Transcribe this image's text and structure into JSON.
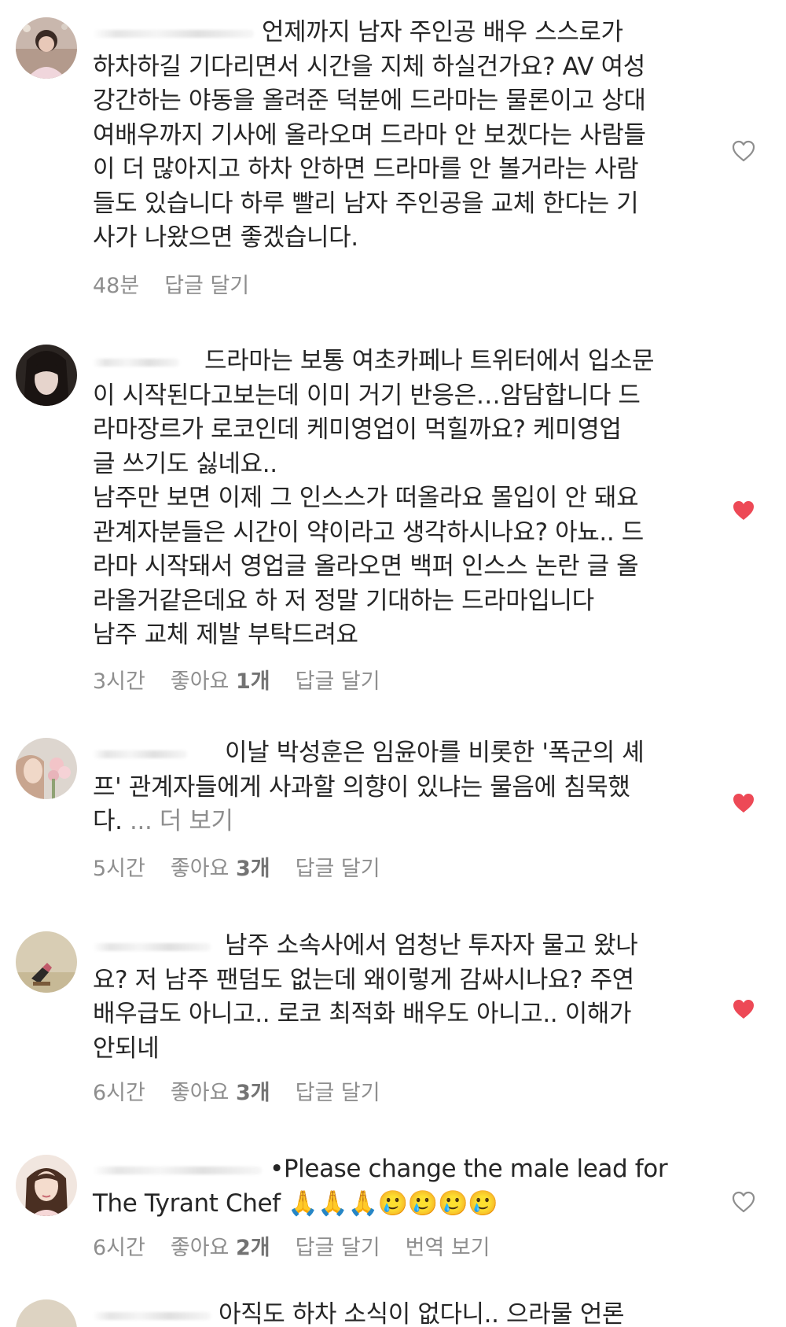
{
  "comments": [
    {
      "text_lines": [
        "언제까지 남자 주인공 배우 스스로가",
        "하차하길 기다리면서 시간을 지체 하실건가요? AV 여성",
        "강간하는 야동을 올려준 덕분에 드라마는 물론이고 상대",
        "여배우까지 기사에 올라오며 드라마 안 보겠다는 사람들",
        "이 더 많아지고 하차 안하면 드라마를 안 볼거라는 사람",
        "들도 있습니다 하루 빨리 남자 주인공을 교체 한다는 기",
        "사가 나왔으면 좋겠습니다."
      ],
      "time": "48분",
      "reply": "답글 달기",
      "liked": false
    },
    {
      "text_lines": [
        "드라마는 보통 여초카페나 트위터에서 입소문",
        "이 시작된다고보는데 이미 거기 반응은…암담합니다 드",
        "라마장르가 로코인데 케미영업이 먹힐까요? 케미영업",
        "글 쓰기도 싫네요..",
        "남주만 보면 이제 그 인스스가 떠올라요 몰입이 안 돼요",
        "관계자분들은 시간이 약이라고 생각하시나요? 아뇨.. 드",
        "라마 시작돼서 영업글 올라오면 백퍼 인스스 논란 글 올",
        "라올거같은데요 하 저 정말 기대하는 드라마입니다",
        "남주 교체 제발 부탁드려요"
      ],
      "time": "3시간",
      "likes_prefix": "좋아요",
      "likes_count": "1개",
      "reply": "답글 달기",
      "liked": true
    },
    {
      "text_lines": [
        "이날 박성훈은 임윤아를 비롯한 '폭군의 셰",
        "프' 관계자들에게 사과할 의향이 있냐는 물음에 침묵했",
        "다. "
      ],
      "more": "... 더 보기",
      "time": "5시간",
      "likes_prefix": "좋아요",
      "likes_count": "3개",
      "reply": "답글 달기",
      "liked": true
    },
    {
      "text_lines": [
        "남주 소속사에서 엄청난 투자자 물고 왔나",
        "요? 저 남주 팬덤도 없는데 왜이렇게 감싸시나요? 주연",
        "배우급도 아니고.. 로코 최적화 배우도 아니고.. 이해가",
        "안되네"
      ],
      "time": "6시간",
      "likes_prefix": "좋아요",
      "likes_count": "3개",
      "reply": "답글 달기",
      "liked": true
    },
    {
      "text_lines": [
        "•Please change the male lead for",
        "The Tyrant Chef 🙏🙏🙏🥲🥲🥲🥲"
      ],
      "time": "6시간",
      "likes_prefix": "좋아요",
      "likes_count": "2개",
      "reply": "답글 달기",
      "translate": "번역 보기",
      "liked": false
    }
  ],
  "partial_comment": {
    "text": "아직도 하차 소식이 없다니.. 으라물 언론"
  },
  "colors": {
    "liked_heart": "#ed4956",
    "meta_text": "#8e8e8e",
    "body_text": "#262626"
  },
  "icons": {
    "like": "heart-icon"
  }
}
